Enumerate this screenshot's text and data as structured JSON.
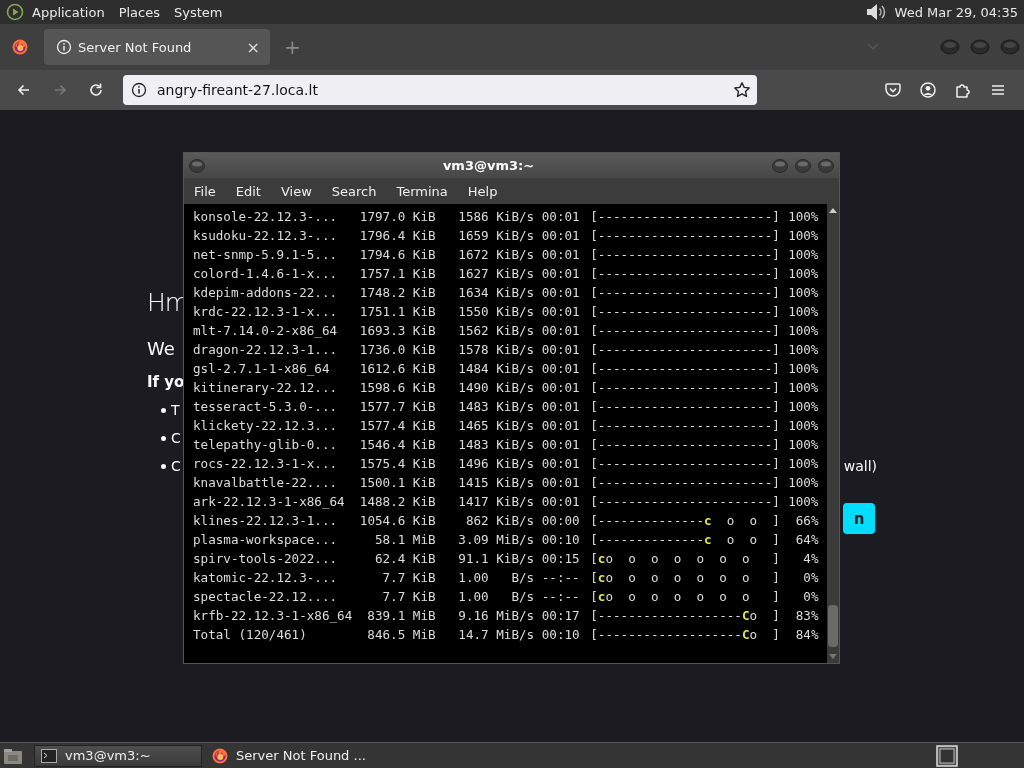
{
  "top_panel": {
    "menus": [
      "Application",
      "Places",
      "System"
    ],
    "clock": "Wed Mar 29, 04:35"
  },
  "browser": {
    "tabs": [
      {
        "title": "Server Not Found",
        "selected": true,
        "close": "×"
      }
    ],
    "new_tab": "+",
    "nav": [
      {
        "kind": "back",
        "disabled": false
      },
      {
        "kind": "forward",
        "disabled": true
      },
      {
        "kind": "reload",
        "disabled": false
      }
    ],
    "address": "angry-fireant-27.loca.lt"
  },
  "error_page": {
    "heading": "Hm",
    "intro": "We",
    "subheading": "If yo",
    "bullets": [
      "T",
      "C",
      "C"
    ],
    "bullet_tail": "wall)",
    "button": "n"
  },
  "terminal": {
    "title": "vm3@vm3:~",
    "menus": [
      "File",
      "Edit",
      "View",
      "Search",
      "Termina",
      "Help"
    ],
    "rows": [
      {
        "name": "konsole-22.12.3-...",
        "size": "1797.0 KiB",
        "rate": "1586 KiB/s",
        "eta": "00:01",
        "bar": {
          "done": "[-----------------------]"
        },
        "percent": "100%"
      },
      {
        "name": "ksudoku-22.12.3-...",
        "size": "1796.4 KiB",
        "rate": "1659 KiB/s",
        "eta": "00:01",
        "bar": {
          "done": "[-----------------------]"
        },
        "percent": "100%"
      },
      {
        "name": "net-snmp-5.9.1-5...",
        "size": "1794.6 KiB",
        "rate": "1672 KiB/s",
        "eta": "00:01",
        "bar": {
          "done": "[-----------------------]"
        },
        "percent": "100%"
      },
      {
        "name": "colord-1.4.6-1-x...",
        "size": "1757.1 KiB",
        "rate": "1627 KiB/s",
        "eta": "00:01",
        "bar": {
          "done": "[-----------------------]"
        },
        "percent": "100%"
      },
      {
        "name": "kdepim-addons-22...",
        "size": "1748.2 KiB",
        "rate": "1634 KiB/s",
        "eta": "00:01",
        "bar": {
          "done": "[-----------------------]"
        },
        "percent": "100%"
      },
      {
        "name": "krdc-22.12.3-1-x...",
        "size": "1751.1 KiB",
        "rate": "1550 KiB/s",
        "eta": "00:01",
        "bar": {
          "done": "[-----------------------]"
        },
        "percent": "100%"
      },
      {
        "name": "mlt-7.14.0-2-x86_64",
        "size": "1693.3 KiB",
        "rate": "1562 KiB/s",
        "eta": "00:01",
        "bar": {
          "done": "[-----------------------]"
        },
        "percent": "100%"
      },
      {
        "name": "dragon-22.12.3-1...",
        "size": "1736.0 KiB",
        "rate": "1578 KiB/s",
        "eta": "00:01",
        "bar": {
          "done": "[-----------------------]"
        },
        "percent": "100%"
      },
      {
        "name": "gsl-2.7.1-1-x86_64",
        "size": "1612.6 KiB",
        "rate": "1484 KiB/s",
        "eta": "00:01",
        "bar": {
          "done": "[-----------------------]"
        },
        "percent": "100%"
      },
      {
        "name": "kitinerary-22.12...",
        "size": "1598.6 KiB",
        "rate": "1490 KiB/s",
        "eta": "00:01",
        "bar": {
          "done": "[-----------------------]"
        },
        "percent": "100%"
      },
      {
        "name": "tesseract-5.3.0-...",
        "size": "1577.7 KiB",
        "rate": "1483 KiB/s",
        "eta": "00:01",
        "bar": {
          "done": "[-----------------------]"
        },
        "percent": "100%"
      },
      {
        "name": "klickety-22.12.3...",
        "size": "1577.4 KiB",
        "rate": "1465 KiB/s",
        "eta": "00:01",
        "bar": {
          "done": "[-----------------------]"
        },
        "percent": "100%"
      },
      {
        "name": "telepathy-glib-0...",
        "size": "1546.4 KiB",
        "rate": "1483 KiB/s",
        "eta": "00:01",
        "bar": {
          "done": "[-----------------------]"
        },
        "percent": "100%"
      },
      {
        "name": "rocs-22.12.3-1-x...",
        "size": "1575.4 KiB",
        "rate": "1496 KiB/s",
        "eta": "00:01",
        "bar": {
          "done": "[-----------------------]"
        },
        "percent": "100%"
      },
      {
        "name": "knavalbattle-22....",
        "size": "1500.1 KiB",
        "rate": "1415 KiB/s",
        "eta": "00:01",
        "bar": {
          "done": "[-----------------------]"
        },
        "percent": "100%"
      },
      {
        "name": "ark-22.12.3-1-x86_64",
        "size": "1488.2 KiB",
        "rate": "1417 KiB/s",
        "eta": "00:01",
        "bar": {
          "done": "[-----------------------]"
        },
        "percent": "100%"
      },
      {
        "name": "klines-22.12.3-1...",
        "size": "1054.6 KiB",
        "rate": "862 KiB/s",
        "eta": "00:00",
        "bar": {
          "done": "[--------------",
          "pacman": "c",
          "rest": "  o  o  ]"
        },
        "percent": "66%"
      },
      {
        "name": "plasma-workspace...",
        "size": "58.1 MiB",
        "rate": "3.09 MiB/s",
        "eta": "00:10",
        "bar": {
          "done": "[--------------",
          "pacman": "c",
          "rest": "  o  o  ]"
        },
        "percent": "64%"
      },
      {
        "name": "spirv-tools-2022...",
        "size": "62.4 KiB",
        "rate": "91.1 KiB/s",
        "eta": "00:15",
        "bar": {
          "done": "[",
          "pacman": "c",
          "rest": "o  o  o  o  o  o  o   ]"
        },
        "percent": "4%"
      },
      {
        "name": "katomic-22.12.3-...",
        "size": "7.7 KiB",
        "rate": "1.00   B/s",
        "eta": "--:--",
        "bar": {
          "done": "[",
          "pacman": "c",
          "rest": "o  o  o  o  o  o  o   ]"
        },
        "percent": "0%"
      },
      {
        "name": "spectacle-22.12....",
        "size": "7.7 KiB",
        "rate": "1.00   B/s",
        "eta": "--:--",
        "bar": {
          "done": "[",
          "pacman": "c",
          "rest": "o  o  o  o  o  o  o   ]"
        },
        "percent": "0%"
      },
      {
        "name": "krfb-22.12.3-1-x86_64",
        "size": "839.1 MiB",
        "rate": "9.16 MiB/s",
        "eta": "00:17",
        "bar": {
          "done": "[-------------------",
          "pacman": "C",
          "rest": "o  ]"
        },
        "percent": "83%"
      },
      {
        "name": "Total (120/461)",
        "size": "846.5 MiB",
        "rate": "14.7 MiB/s",
        "eta": "00:10",
        "bar": {
          "done": "[-------------------",
          "pacman": "C",
          "rest": "o  ]"
        },
        "percent": "84%"
      }
    ]
  },
  "taskbar": {
    "items": [
      {
        "kind": "terminal",
        "label": "vm3@vm3:~",
        "selected": true
      },
      {
        "kind": "browser",
        "label": "Server Not Found ...",
        "selected": false
      }
    ]
  }
}
